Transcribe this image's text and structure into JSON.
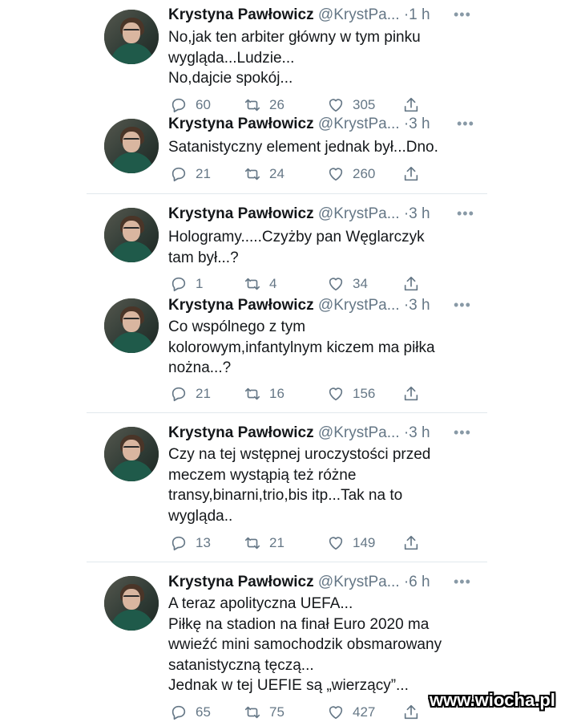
{
  "tweets": [
    {
      "name": "Krystyna Pawłowicz",
      "handle": "@KrystPa...",
      "dot": "·",
      "time": "1 h",
      "more": "•••",
      "lines": [
        "No,jak ten arbiter główny w tym pinku",
        "wygląda...Ludzie...",
        "No,dajcie spokój..."
      ],
      "replies": "60",
      "retweets": "26",
      "likes": "305"
    },
    {
      "name": "Krystyna Pawłowicz",
      "handle": "@KrystPa...",
      "dot": "·",
      "time": "3 h",
      "more": "•••",
      "lines": [
        "Satanistyczny element jednak był...Dno."
      ],
      "replies": "21",
      "retweets": "24",
      "likes": "260"
    },
    {
      "name": "Krystyna Pawłowicz",
      "handle": "@KrystPa...",
      "dot": "·",
      "time": "3 h",
      "more": "•••",
      "lines": [
        "Hologramy.....Czyżby pan Węglarczyk",
        "tam był...?"
      ],
      "replies": "1",
      "retweets": "4",
      "likes": "34"
    },
    {
      "name": "Krystyna Pawłowicz",
      "handle": "@KrystPa...",
      "dot": "·",
      "time": "3 h",
      "more": "•••",
      "lines": [
        "Co wspólnego z tym",
        "kolorowym,infantylnym kiczem ma piłka",
        "nożna...?"
      ],
      "replies": "21",
      "retweets": "16",
      "likes": "156"
    },
    {
      "name": "Krystyna Pawłowicz",
      "handle": "@KrystPa...",
      "dot": "·",
      "time": "3 h",
      "more": "•••",
      "lines": [
        "Czy na tej wstępnej uroczystości przed",
        "meczem wystąpią też różne",
        "transy,binarni,trio,bis itp...Tak na to",
        "wygląda.."
      ],
      "replies": "13",
      "retweets": "21",
      "likes": "149"
    },
    {
      "name": "Krystyna Pawłowicz",
      "handle": "@KrystPa...",
      "dot": "·",
      "time": "6 h",
      "more": "•••",
      "lines": [
        "A teraz apolityczna UEFA...",
        "Piłkę na stadion na finał Euro 2020 ma",
        "wwieźć mini samochodzik obsmarowany",
        "satanistyczną tęczą...",
        "Jednak w tej UEFIE są „wierzący”..."
      ],
      "replies": "65",
      "retweets": "75",
      "likes": "427"
    }
  ],
  "watermark": "www.wiocha.pl",
  "colors": {
    "text": "#14171a",
    "muted": "#657786",
    "divider": "#e1e8ed"
  }
}
